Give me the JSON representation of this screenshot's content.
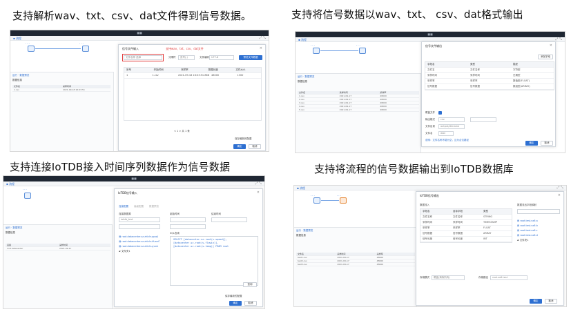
{
  "captions": {
    "c1": "支持解析wav、txt、csv、dat文件得到信号数据。",
    "c2": "支持将信号数据以wav、txt、 csv、dat格式输出",
    "c3": "支持连接IoTDB接入时间序列数据作为信号数据",
    "c4": "支持将流程的信号数据输出到IoTDB数据库"
  },
  "shot1": {
    "dialog_title": "信号文件输入",
    "file_label": "文件名称",
    "file_placeholder": "选择",
    "red_note": "支持wav、txt、csv、dat文件",
    "separator_label": "分隔符",
    "separator_value": "逗号(,)",
    "encoding_label": "文件编码",
    "encoding_value": "UTF-8",
    "preview_button": "预览文件数据",
    "columns": [
      "序号",
      "开始时间",
      "采样率",
      "数据长度",
      "文件大小"
    ],
    "row": [
      "1",
      "1.csv",
      "2021-09-18 16:03:51:868",
      "48000",
      "1300"
    ],
    "pager": "< 1 >   共 1 条",
    "footer_check": "保存最新的配置",
    "ok": "确定",
    "cancel": "取消"
  },
  "shot2": {
    "dialog_title": "信号文件输出",
    "add_button": "添加字段",
    "columns": [
      "字段名",
      "类型",
      "描述"
    ],
    "rows": [
      [
        "文件名",
        "文件名称",
        "字符型"
      ],
      [
        "采样时间",
        "采样时间",
        "日期型"
      ],
      [
        "采样率",
        "采样率",
        "数值型(FLOAT)"
      ],
      [
        "信号数据",
        "信号数据",
        "数组型(ARRAY)"
      ]
    ],
    "overwrite_label": "覆盖文件",
    "format_label": "输出格式",
    "format_value": "csv",
    "dir_label": "文件目录",
    "dir_value": "output/dirname",
    "name_label": "文件名",
    "name_value": "wav",
    "hint": "说明：文件名称不能为空，且为合法路径",
    "ok": "确定",
    "cancel": "取消"
  },
  "shot3": {
    "dialog_title": "IoTDB信号输入",
    "tabs": [
      "连接配置",
      "高级配置",
      "数据预览"
    ],
    "conn_label": "连接数据源",
    "conn_value": "iotdb_test",
    "start_label": "起始时间",
    "end_label": "结束时间",
    "files": [
      "root.datacenter.sz.zhichuguoji",
      "root.datacenter.sz.zhichuYuanC",
      "root.datacenter.sz.zhichuyunk",
      "文件夹1"
    ],
    "sql_label": "SQL查询",
    "sql_lines": [
      "SELECT [datacenter.sz.root(s.speed)],",
      "[datacenter.sz.root(s.flowin)],",
      "[datacenter.sz.root(s.temp)] FROM root"
    ],
    "query_button": "查询",
    "footer_check": "保存最新的配置",
    "ok": "确定",
    "cancel": "取消"
  },
  "shot4": {
    "dialog_title": "IoTDB信号输出",
    "left_title": "数据流入",
    "right_title": "数据流出字段映射",
    "columns": [
      "字段名",
      "目标字段",
      "类型"
    ],
    "rows": [
      [
        "文件名称",
        "文件名称",
        "STRING"
      ],
      [
        "采样时间",
        "采样时间",
        "TIMESTAMP"
      ],
      [
        "采样率",
        "采样率",
        "FLOAT"
      ],
      [
        "信号数据",
        "信号数据",
        "ARRAY"
      ],
      [
        "信号长度",
        "信号长度",
        "INT"
      ]
    ],
    "targets": [
      "root.test.sx6.a",
      "root.test.sx6.b",
      "root.test.sx6.c",
      "root.test.sx6.d",
      "文件夹1"
    ],
    "mode_label": "存储模式",
    "mode_value": "覆盖(清除所有)",
    "path_label": "存储路径",
    "path_value": "root.sx6.test",
    "ok": "确定",
    "cancel": "取消"
  }
}
